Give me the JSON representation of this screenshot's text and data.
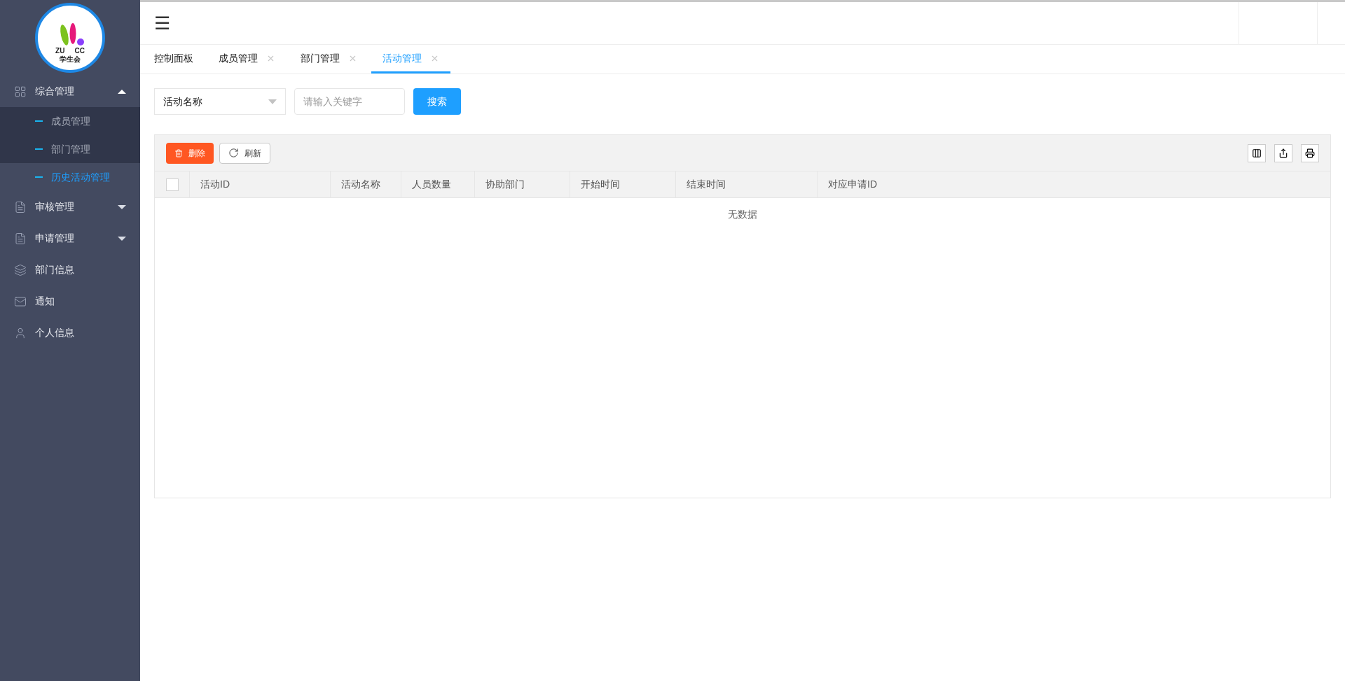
{
  "logo": {
    "left": "ZU",
    "right": "CC",
    "name": "学生会"
  },
  "sidebar": {
    "items": [
      {
        "label": "综合管理",
        "expanded": true,
        "children": [
          {
            "label": "成员管理",
            "selected": false
          },
          {
            "label": "部门管理",
            "selected": false
          },
          {
            "label": "历史活动管理",
            "selected": true
          }
        ]
      },
      {
        "label": "审核管理",
        "expanded": false
      },
      {
        "label": "申请管理",
        "expanded": false
      },
      {
        "label": "部门信息"
      },
      {
        "label": "通知"
      },
      {
        "label": "个人信息"
      }
    ]
  },
  "topbar": {
    "menu_glyph": "☰"
  },
  "tabs": [
    {
      "label": "控制面板",
      "closable": false,
      "selected": false
    },
    {
      "label": "成员管理",
      "closable": true,
      "selected": false
    },
    {
      "label": "部门管理",
      "closable": true,
      "selected": false
    },
    {
      "label": "活动管理",
      "closable": true,
      "selected": true
    }
  ],
  "search": {
    "field_select": "活动名称",
    "placeholder": "请输入关键字",
    "button": "搜索"
  },
  "table": {
    "buttons": [
      {
        "label": "删除",
        "kind": "danger"
      },
      {
        "label": "刷新",
        "kind": "plain"
      }
    ],
    "columns": [
      "活动ID",
      "活动名称",
      "人员数量",
      "协助部门",
      "开始时间",
      "结束时间",
      "对应申请ID"
    ],
    "checked_all": false,
    "empty_text": "无数据"
  }
}
